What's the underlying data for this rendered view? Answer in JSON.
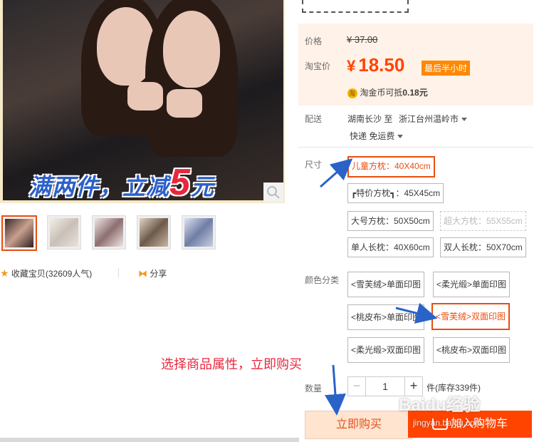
{
  "promo": {
    "text_a": "满两件，立减",
    "text_big": "5",
    "text_b": "元"
  },
  "favorite": {
    "label": "收藏宝贝",
    "count": "(32609人气)"
  },
  "share": {
    "label": "分享"
  },
  "price": {
    "label": "价格",
    "original": "¥ 37.00",
    "tb_label": "淘宝价",
    "tb_yen": "¥",
    "tb_value": "18.50",
    "badge": "最后半小时",
    "coin_text": "淘金币可抵",
    "coin_value": "0.18元"
  },
  "delivery": {
    "label": "配送",
    "from": "湖南长沙 至",
    "to": "浙江台州温岭市",
    "method": "快递 免运费"
  },
  "size": {
    "label": "尺寸",
    "options": [
      "儿童方枕：40X40cm",
      "┏特价方枕┓：45X45cm",
      "大号方枕：50X50cm",
      "超大方枕：55X55cm",
      "单人长枕：40X60cm",
      "双人长枕：50X70cm"
    ]
  },
  "color": {
    "label": "颜色分类",
    "options": [
      "<雪芙绒>单面印图",
      "<柔光缎>单面印图",
      "<桃皮布>单面印图",
      "<雪芙绒>双面印图",
      "<柔光缎>双面印图",
      "<桃皮布>双面印图"
    ]
  },
  "annotation": "选择商品属性，立即购买",
  "quantity": {
    "label": "数量",
    "minus": "−",
    "value": "1",
    "plus": "+",
    "stock": "件(库存339件)"
  },
  "buttons": {
    "buy_now": "立即购买",
    "add_cart": "加入购物车"
  },
  "watermark": {
    "main": "Baidu经验",
    "sub": "jingyan.baidu.com"
  },
  "colors": {
    "accent": "#ff4400",
    "selected_border": "#e84e0f",
    "annotation": "#e8273e",
    "arrow": "#2a63c8"
  }
}
